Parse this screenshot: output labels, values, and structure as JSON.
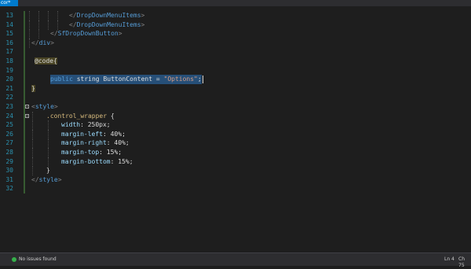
{
  "window": {
    "tab_label": "cor*"
  },
  "editor": {
    "lines": [
      {
        "num": "13",
        "parts": [
          {
            "t": "</",
            "c": "bracket"
          },
          {
            "t": "DropDownMenuItems",
            "c": "tag"
          },
          {
            "t": ">",
            "c": "bracket"
          }
        ]
      },
      {
        "num": "14",
        "parts": [
          {
            "t": "</",
            "c": "bracket"
          },
          {
            "t": "DropDownMenuItems",
            "c": "tag"
          },
          {
            "t": ">",
            "c": "bracket"
          }
        ]
      },
      {
        "num": "15",
        "parts": [
          {
            "t": "</",
            "c": "bracket"
          },
          {
            "t": "SfDropDownButton",
            "c": "tag"
          },
          {
            "t": ">",
            "c": "bracket"
          }
        ]
      },
      {
        "num": "16",
        "parts": [
          {
            "t": "</",
            "c": "bracket"
          },
          {
            "t": "div",
            "c": "tag"
          },
          {
            "t": ">",
            "c": "bracket"
          }
        ]
      },
      {
        "num": "17",
        "parts": []
      },
      {
        "num": "18",
        "parts": [
          {
            "t": "@code{",
            "c": "razor"
          }
        ]
      },
      {
        "num": "19",
        "parts": []
      },
      {
        "num": "20",
        "parts": [
          {
            "t": "public",
            "c": "kw"
          },
          {
            "t": " string ",
            "c": "ident"
          },
          {
            "t": "ButtonContent",
            "c": "ident"
          },
          {
            "t": " = ",
            "c": "ident"
          },
          {
            "t": "\"Options\"",
            "c": "str"
          },
          {
            "t": ";",
            "c": "ident"
          }
        ]
      },
      {
        "num": "21",
        "parts": [
          {
            "t": "}",
            "c": "razor"
          }
        ]
      },
      {
        "num": "22",
        "parts": []
      },
      {
        "num": "23",
        "parts": [
          {
            "t": "<",
            "c": "bracket"
          },
          {
            "t": "style",
            "c": "tag"
          },
          {
            "t": ">",
            "c": "bracket"
          }
        ]
      },
      {
        "num": "24",
        "parts": [
          {
            "t": ".control_wrapper",
            "c": "css-sel"
          },
          {
            "t": " {",
            "c": "ident"
          }
        ]
      },
      {
        "num": "25",
        "parts": [
          {
            "t": "width",
            "c": "css-prop"
          },
          {
            "t": ": 250px;",
            "c": "css-val"
          }
        ]
      },
      {
        "num": "26",
        "parts": [
          {
            "t": "margin-left",
            "c": "css-prop"
          },
          {
            "t": ": 40%;",
            "c": "css-val"
          }
        ]
      },
      {
        "num": "27",
        "parts": [
          {
            "t": "margin-right",
            "c": "css-prop"
          },
          {
            "t": ": 40%;",
            "c": "css-val"
          }
        ]
      },
      {
        "num": "28",
        "parts": [
          {
            "t": "margin-top",
            "c": "css-prop"
          },
          {
            "t": ": 15%;",
            "c": "css-val"
          }
        ]
      },
      {
        "num": "29",
        "parts": [
          {
            "t": "margin-bottom",
            "c": "css-prop"
          },
          {
            "t": ": 15%;",
            "c": "css-val"
          }
        ]
      },
      {
        "num": "30",
        "parts": [
          {
            "t": "}",
            "c": "ident"
          }
        ]
      },
      {
        "num": "31",
        "parts": [
          {
            "t": "</",
            "c": "bracket"
          },
          {
            "t": "style",
            "c": "tag"
          },
          {
            "t": ">",
            "c": "bracket"
          }
        ]
      },
      {
        "num": "32",
        "parts": []
      }
    ]
  },
  "statusbar": {
    "issues_icon": "check-circle-icon",
    "issues_text": "No issues found",
    "line_label": "Ln 4",
    "char_label": "Ch 75",
    "ok_color": "#35b04a"
  }
}
